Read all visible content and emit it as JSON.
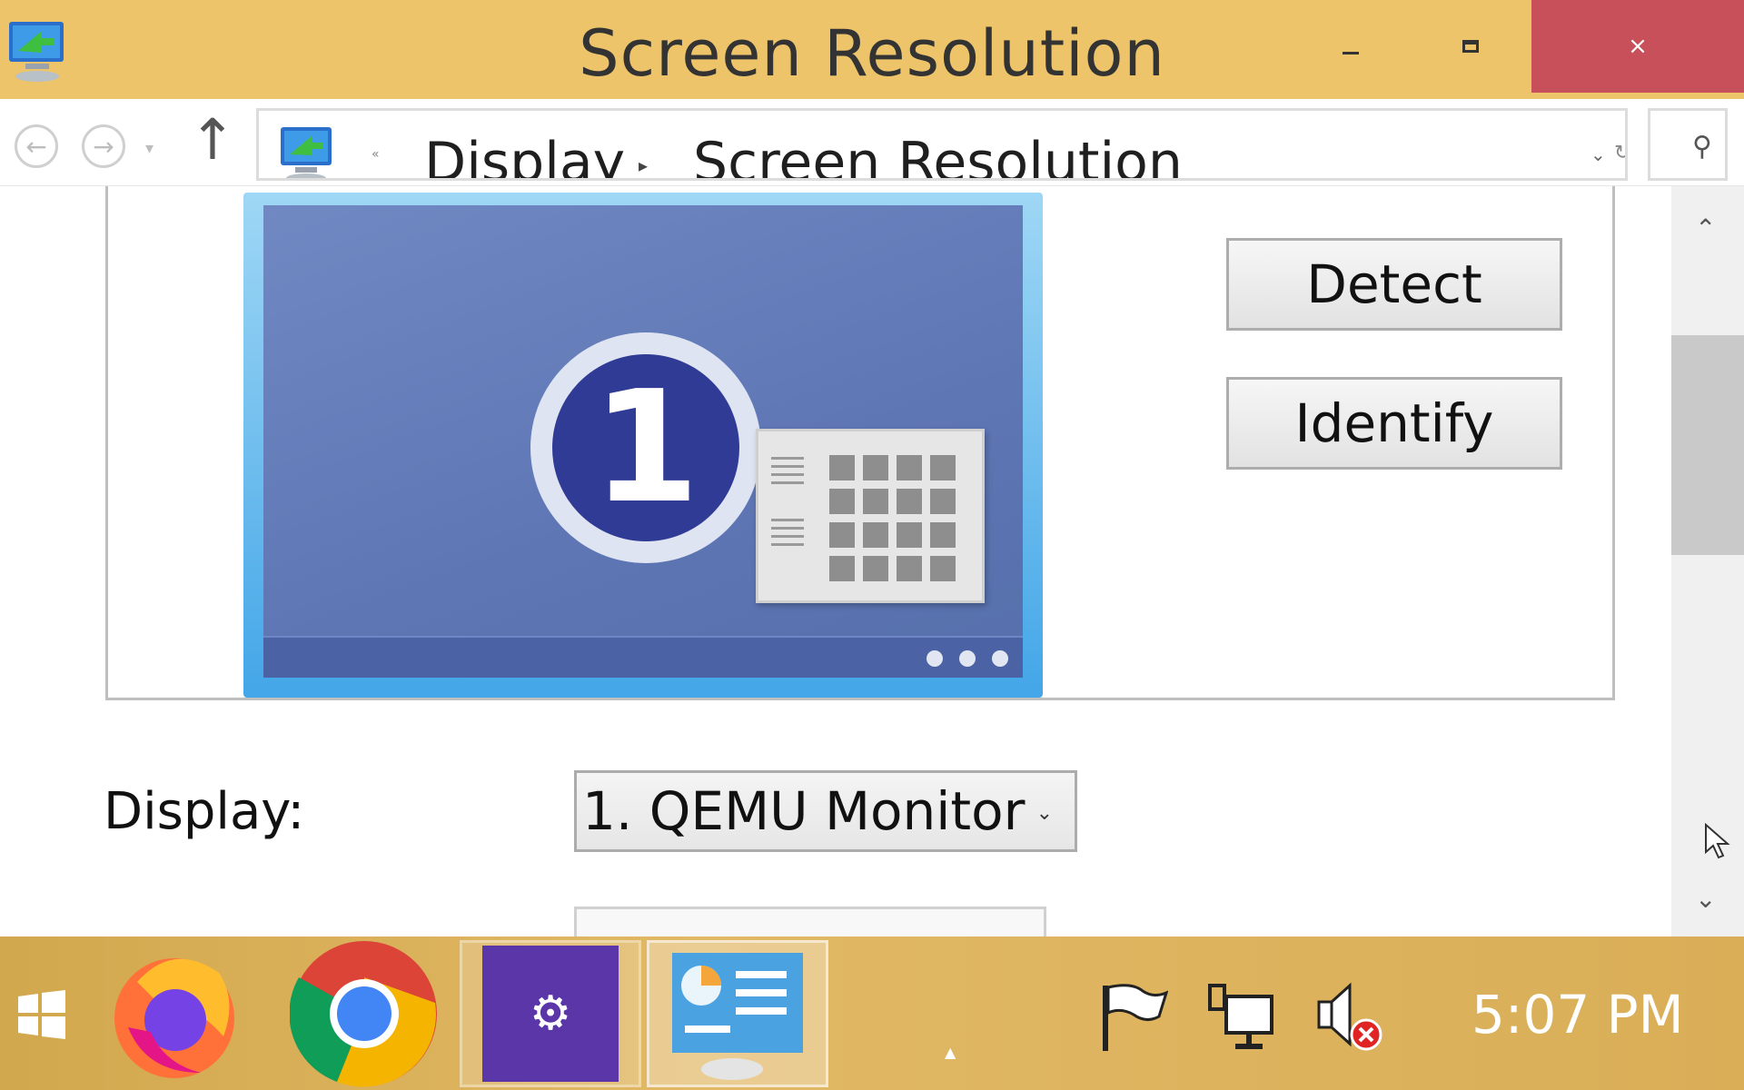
{
  "window": {
    "title": "Screen Resolution",
    "minimize_label": "–",
    "maximize_label": "",
    "close_label": "×"
  },
  "nav": {
    "breadcrumb_prefix": "«",
    "breadcrumb": [
      "Display",
      "Screen Resolution"
    ]
  },
  "preview": {
    "monitor_number": "1"
  },
  "buttons": {
    "detect": "Detect",
    "identify": "Identify"
  },
  "display_field": {
    "label": "Display:",
    "value": "1. QEMU Monitor"
  },
  "taskbar": {
    "apps": [
      "firefox-icon",
      "chrome-icon",
      "settings-icon",
      "control-panel-icon"
    ],
    "clock": "5:07 PM"
  },
  "colors": {
    "titlebar": "#eec46a",
    "close": "#c7505a",
    "taskbar": "#d9ae57",
    "monitor_badge": "#2f3b94"
  }
}
